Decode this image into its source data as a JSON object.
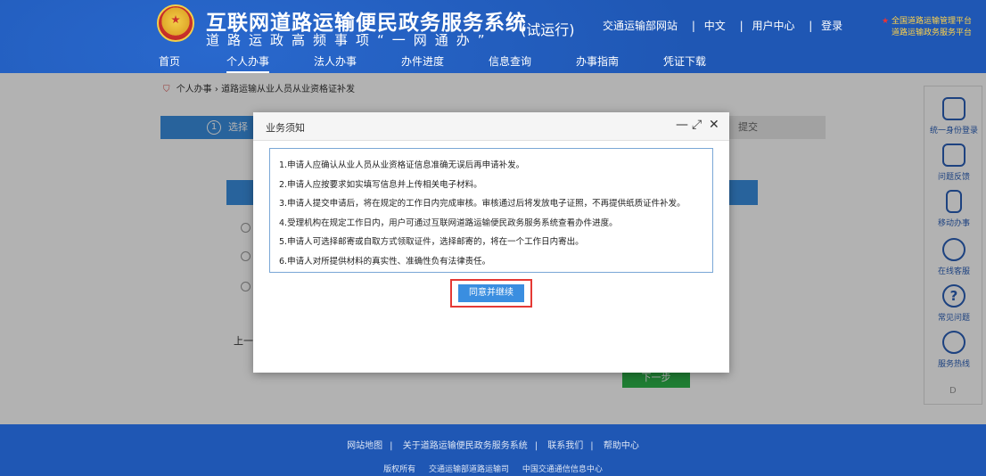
{
  "header": {
    "title": "互联网道路运输便民政务服务系统",
    "subtitle": "道路运政高频事项“一网通办”",
    "trial": "(试运行)",
    "links": [
      "交通运输部网站",
      "中文",
      "用户中心",
      "登录"
    ],
    "platform_line1": "全国道路运输管理平台",
    "platform_line2": "道路运输政务服务平台"
  },
  "nav": {
    "items": [
      "首页",
      "个人办事",
      "法人办事",
      "办件进度",
      "信息查询",
      "办事指南",
      "凭证下载"
    ]
  },
  "breadcrumb": {
    "root": "个人办事",
    "current": "道路运输从业人员从业资格证补发"
  },
  "steps": {
    "first_number": "1",
    "first_label": "选择",
    "last_label": "提交"
  },
  "page": {
    "prev_label": "上一步",
    "next_label": "下一步"
  },
  "right_panel": {
    "items": [
      "统一身份登录",
      "问题反馈",
      "移动办事",
      "在线客服",
      "常见问题",
      "服务热线"
    ],
    "d": "D"
  },
  "footer": {
    "links": [
      "网站地图",
      "关于道路运输便民政务服务系统",
      "联系我们",
      "帮助中心"
    ],
    "info": [
      "版权所有",
      "交通运输部道路运输司",
      "中国交通通信信息中心"
    ]
  },
  "modal": {
    "title": "业务须知",
    "notices": [
      "1.申请人应确认从业人员从业资格证信息准确无误后再申请补发。",
      "2.申请人应按要求如实填写信息并上传相关电子材料。",
      "3.申请人提交申请后，将在规定的工作日内完成审核。审核通过后将发放电子证照，不再提供纸质证件补发。",
      "4.受理机构在规定工作日内，用户可通过互联网道路运输便民政务服务系统查看办件进度。",
      "5.申请人可选择邮寄或自取方式领取证件，选择邮寄的，将在一个工作日内寄出。",
      "6.申请人对所提供材料的真实性、准确性负有法律责任。"
    ],
    "agree_label": "同意并继续"
  }
}
